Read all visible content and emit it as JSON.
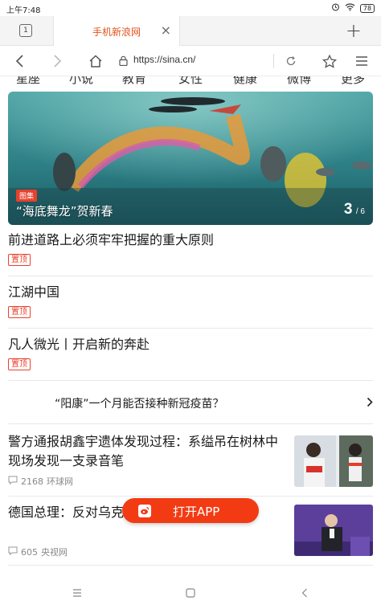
{
  "status_bar": {
    "time": "上午7:48",
    "battery": "78"
  },
  "tabs": {
    "count": "1",
    "active_title": "手机新浪网"
  },
  "address_bar": {
    "url": "https://sina.cn/"
  },
  "categories": [
    "星座",
    "小说",
    "教育",
    "女性",
    "健康",
    "微博",
    "更多"
  ],
  "hero": {
    "badge": "图集",
    "caption": "“海底舞龙”贺新春",
    "page_current": "3",
    "page_total": "/ 6"
  },
  "articles": [
    {
      "title": "前进道路上必须牢牢把握的重大原则",
      "tag": "置顶"
    },
    {
      "title": "江湖中国",
      "tag": "置顶"
    },
    {
      "title": "凡人微光丨开启新的奔赴",
      "tag": "置顶"
    }
  ],
  "question": {
    "text": "“阳康”一个月能否接种新冠疫苗？"
  },
  "news": [
    {
      "title": "警方通报胡鑫宇遗体发现过程：系缢吊在树林中 现场发现一支录音笔",
      "comments": "2168",
      "source": "环球网"
    },
    {
      "title": "德国总理：反对乌克",
      "comments": "605",
      "source": "央视网"
    }
  ],
  "open_app": {
    "label": "打开APP"
  },
  "colors": {
    "accent": "#f33b13",
    "tag_red": "#e8402c",
    "tab_title": "#e2531c"
  }
}
